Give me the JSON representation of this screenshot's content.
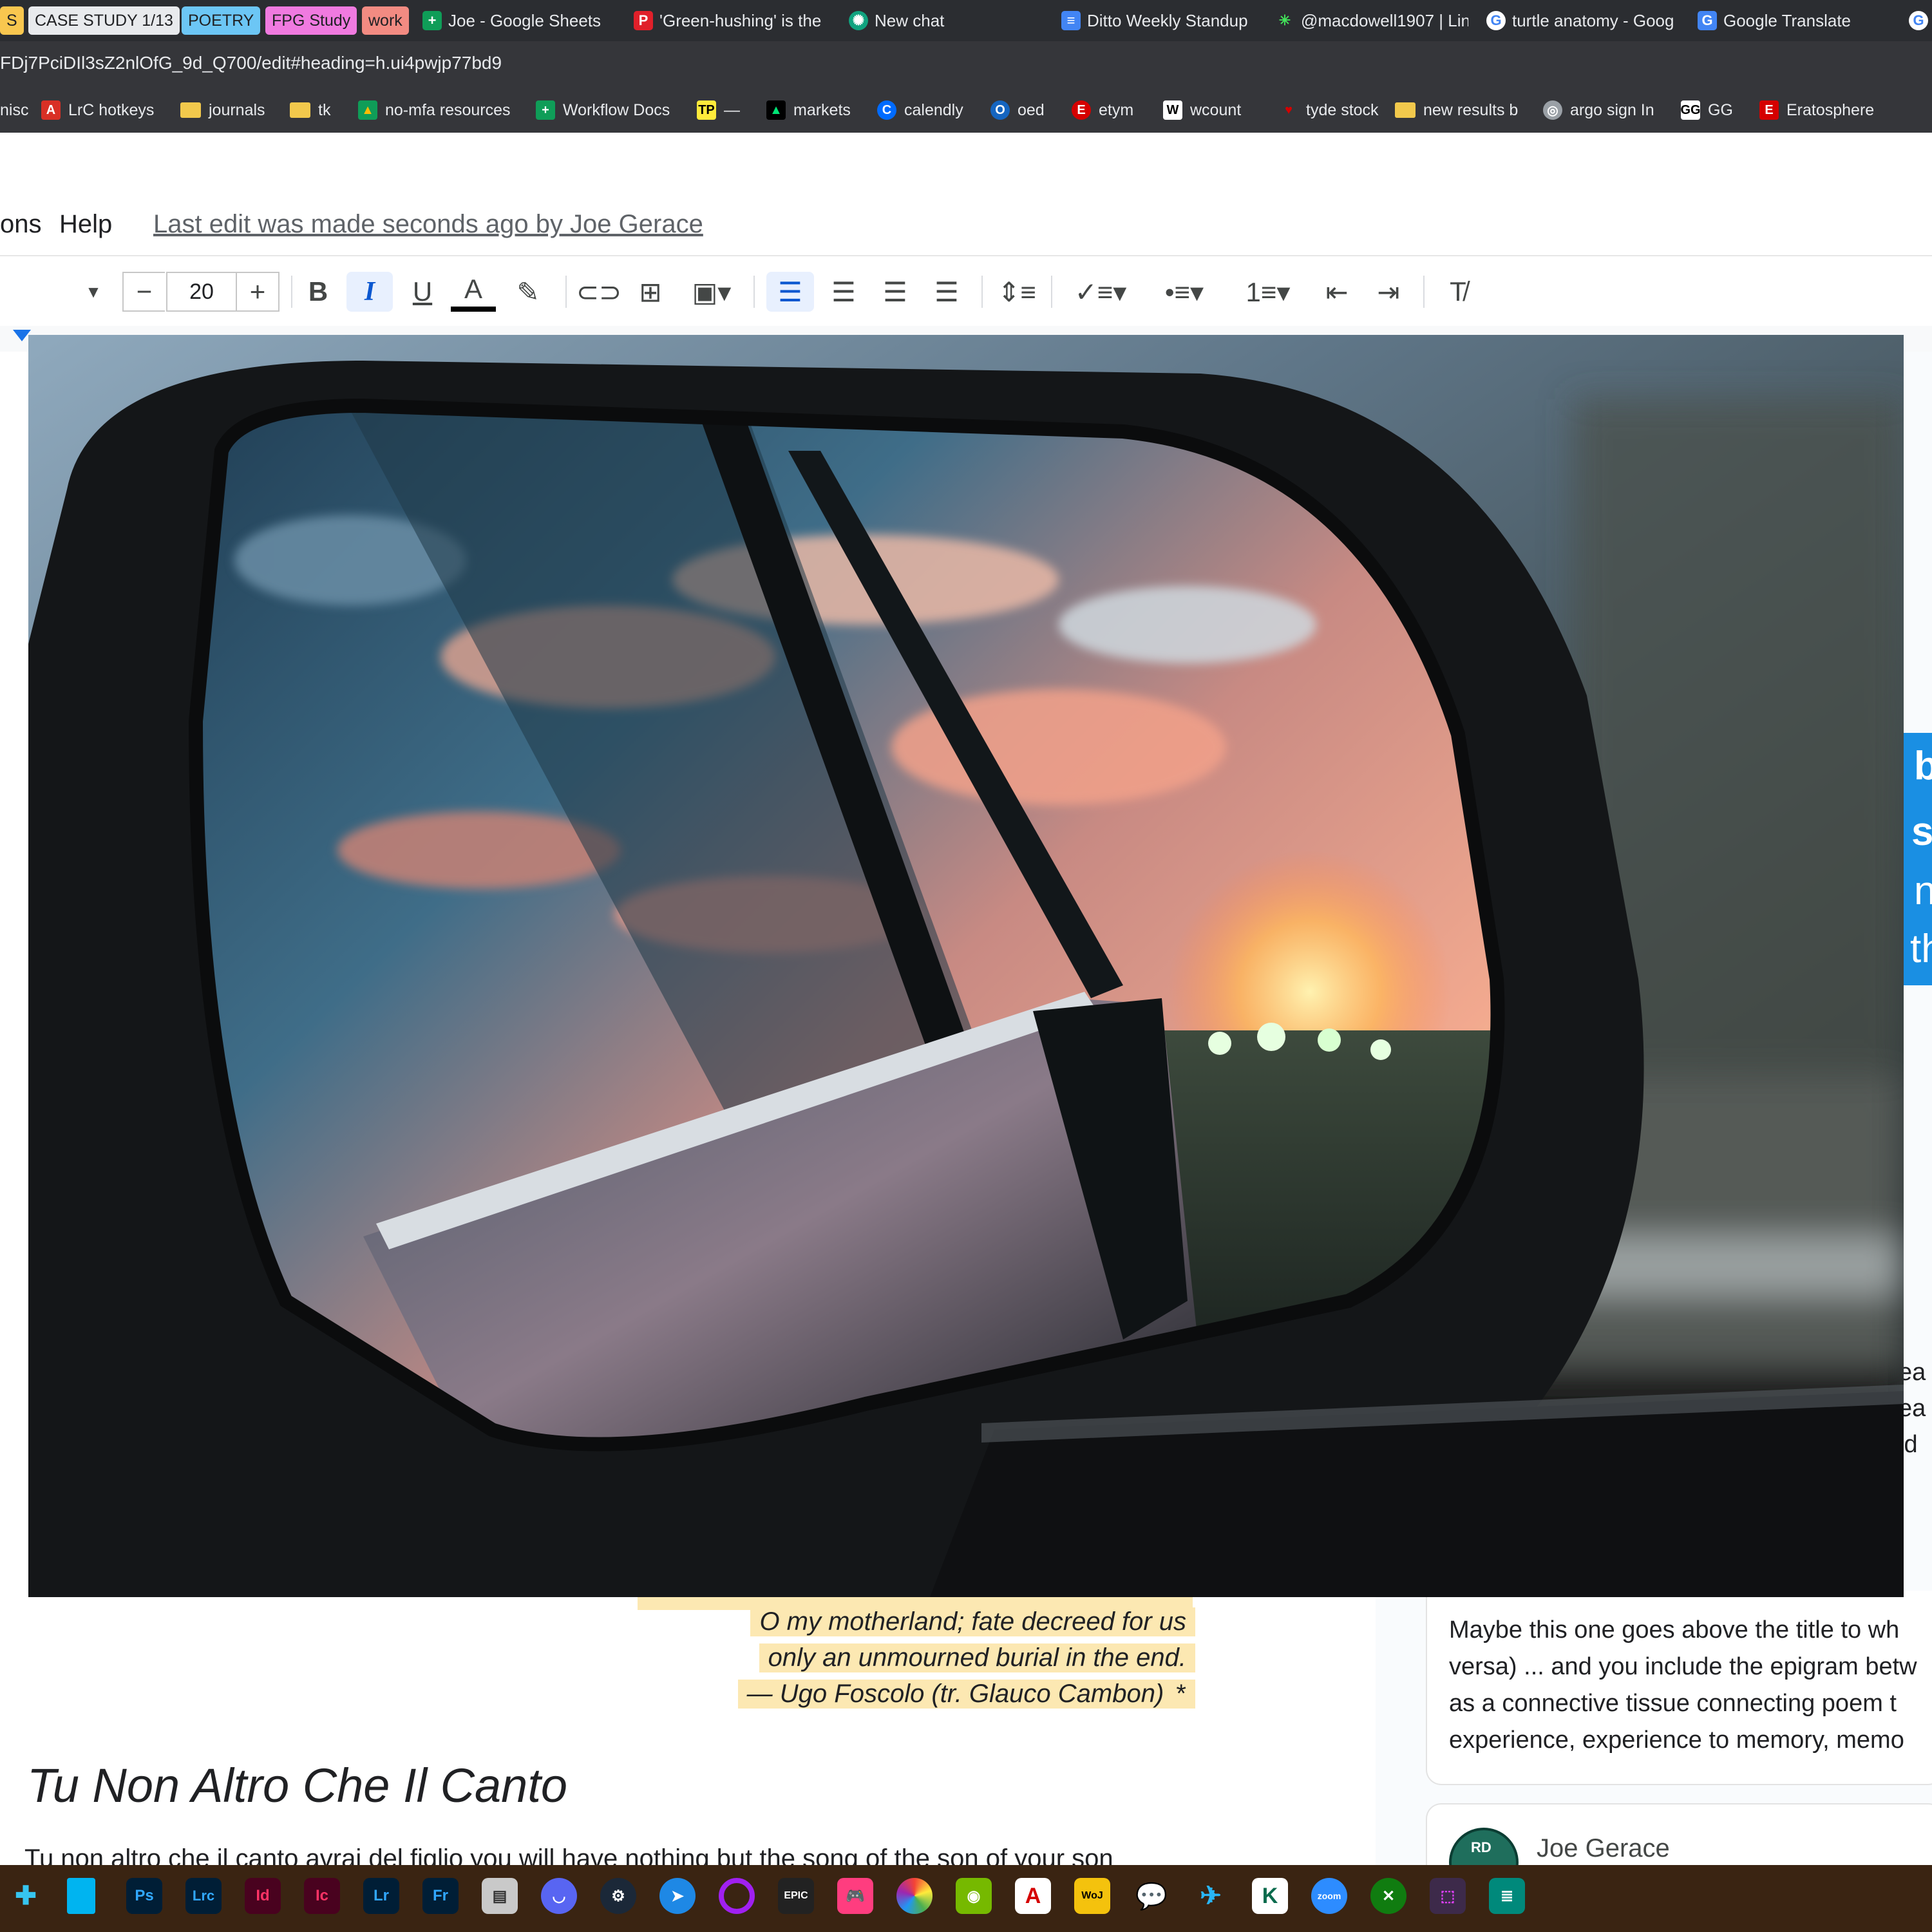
{
  "tabs": [
    {
      "label": "S"
    },
    {
      "label": "CASE STUDY 1/13"
    },
    {
      "label": "POETRY"
    },
    {
      "label": "FPG Study"
    },
    {
      "label": "work"
    },
    {
      "label": "Joe - Google Sheets"
    },
    {
      "label": "'Green-hushing' is the"
    },
    {
      "label": "New chat"
    },
    {
      "label": "Ditto Weekly Standup"
    },
    {
      "label": "@macdowell1907 | Lin"
    },
    {
      "label": "turtle anatomy - Goog"
    },
    {
      "label": "Google Translate"
    },
    {
      "label": "G"
    }
  ],
  "url": "FDj7PciDIl3sZ2nlOfG_9d_Q700/edit#heading=h.ui4pwjp77bd9",
  "bookmarks": [
    {
      "label": "nisc"
    },
    {
      "label": "LrC hotkeys"
    },
    {
      "label": "journals"
    },
    {
      "label": "tk"
    },
    {
      "label": "no-mfa resources"
    },
    {
      "label": "Workflow Docs"
    },
    {
      "label": "—"
    },
    {
      "label": "markets"
    },
    {
      "label": "calendly"
    },
    {
      "label": "oed"
    },
    {
      "label": "etym"
    },
    {
      "label": "wcount"
    },
    {
      "label": "tyde stock"
    },
    {
      "label": "new results b"
    },
    {
      "label": "argo sign In"
    },
    {
      "label": "GG"
    },
    {
      "label": "Eratosphere"
    }
  ],
  "menu": {
    "items": [
      "ons",
      "Help"
    ],
    "last_edit": "Last edit was made seconds ago by Joe Gerace"
  },
  "toolbar": {
    "font_size": "20",
    "minus": "−",
    "plus": "+",
    "bold": "B",
    "italic": "I",
    "underline": "U",
    "text_color": "A"
  },
  "document": {
    "quote_lines": [
      "O my motherland; fate decreed for us",
      "only an unmourned burial in the end.",
      "— Ugo Foscolo (tr. Glauco Cambon)"
    ],
    "quote_marker": "*",
    "poem_title": "Tu Non Altro Che Il Canto",
    "poem_first_line": "Tu non altro che il canto avrai del figlio you will have nothing but the song of the son of your son"
  },
  "comments": {
    "partial_text": [
      "ea",
      "ea",
      "ld"
    ],
    "blue_card_text": [
      "b",
      "se",
      "n",
      "th"
    ],
    "comment_lines": [
      "Maybe this one goes above the title to wh",
      "versa) ... and you include the epigram betw",
      "as a connective tissue connecting poem t",
      "experience, experience to memory, memo"
    ],
    "author": "Joe Gerace",
    "avatar_initials": "RD"
  },
  "taskbar": [
    {
      "label": "slack-icon"
    },
    {
      "label": "files-icon"
    },
    {
      "label": "Ps"
    },
    {
      "label": "Lrc"
    },
    {
      "label": "Id"
    },
    {
      "label": "Ic"
    },
    {
      "label": "Lr"
    },
    {
      "label": "Fr"
    },
    {
      "label": "explorer-icon"
    },
    {
      "label": "discord-icon"
    },
    {
      "label": "steam-icon"
    },
    {
      "label": "app-icon"
    },
    {
      "label": "circle-icon"
    },
    {
      "label": "EPIC"
    },
    {
      "label": "game-icon"
    },
    {
      "label": "color-icon"
    },
    {
      "label": "nvidia-icon"
    },
    {
      "label": "A"
    },
    {
      "label": "WoJ"
    },
    {
      "label": "chat-icon"
    },
    {
      "label": "bird-icon"
    },
    {
      "label": "K"
    },
    {
      "label": "zoom"
    },
    {
      "label": "xbox-icon"
    },
    {
      "label": "tool-icon"
    },
    {
      "label": "notes-icon"
    }
  ],
  "colors": {
    "highlight": "#fce8b2",
    "link_blue": "#1a8fe3",
    "taskbar": "#3a2412"
  }
}
